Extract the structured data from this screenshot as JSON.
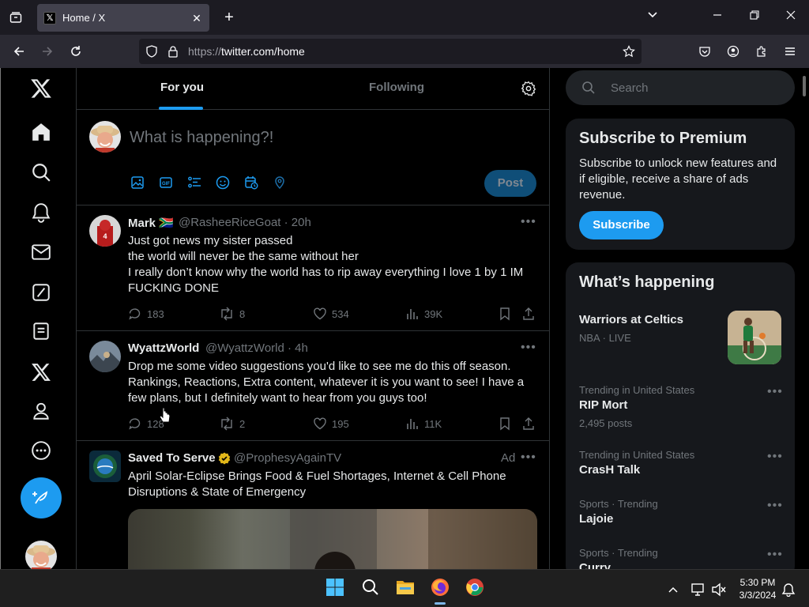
{
  "browser": {
    "tab_title": "Home / X",
    "url_prefix": "https://",
    "url_host": "twitter.com/home"
  },
  "feed": {
    "tabs": [
      "For you",
      "Following"
    ],
    "active_tab": "For you",
    "composer": {
      "placeholder": "What is happening?!",
      "post_label": "Post"
    },
    "tweets": [
      {
        "name": "Mark 🇿🇦",
        "handle": "@RasheeRiceGoat · 20h",
        "text": "Just got news my sister passed\nthe world will never be the same without her\nI really don’t know why the world has to rip away everything I love 1 by 1 IM FUCKING DONE",
        "replies": "183",
        "reposts": "8",
        "likes": "534",
        "views": "39K"
      },
      {
        "name": "WyattzWorld",
        "handle": "@WyattzWorld · 4h",
        "text": "Drop me some video suggestions you'd like to see me do this off season. Rankings, Reactions, Extra content, whatever it is you want to see! I have a few plans, but I definitely want to hear from you guys too!",
        "replies": "128",
        "reposts": "2",
        "likes": "195",
        "views": "11K"
      },
      {
        "name": "Saved To Serve",
        "handle": "@ProphesyAgainTV",
        "ad_label": "Ad",
        "text": "April Solar-Eclipse Brings Food & Fuel Shortages, Internet & Cell Phone Disruptions & State of Emergency"
      }
    ]
  },
  "sidebar": {
    "search_placeholder": "Search",
    "premium": {
      "title": "Subscribe to Premium",
      "text": "Subscribe to unlock new features and if eligible, receive a share of ads revenue.",
      "button": "Subscribe"
    },
    "happening": {
      "title": "What’s happening",
      "items": [
        {
          "title": "Warriors at Celtics",
          "context": "NBA · LIVE"
        },
        {
          "context": "Trending in United States",
          "title": "RIP Mort",
          "count": "2,495 posts"
        },
        {
          "context": "Trending in United States",
          "title": "CrasH Talk"
        },
        {
          "context": "Sports · Trending",
          "title": "Lajoie"
        },
        {
          "context": "Sports · Trending",
          "title": "Curry"
        }
      ]
    }
  },
  "taskbar": {
    "time": "5:30 PM",
    "date": "3/3/2024"
  },
  "colors": {
    "accent": "#1d9bf0",
    "background": "#000000",
    "card": "#16181c"
  }
}
